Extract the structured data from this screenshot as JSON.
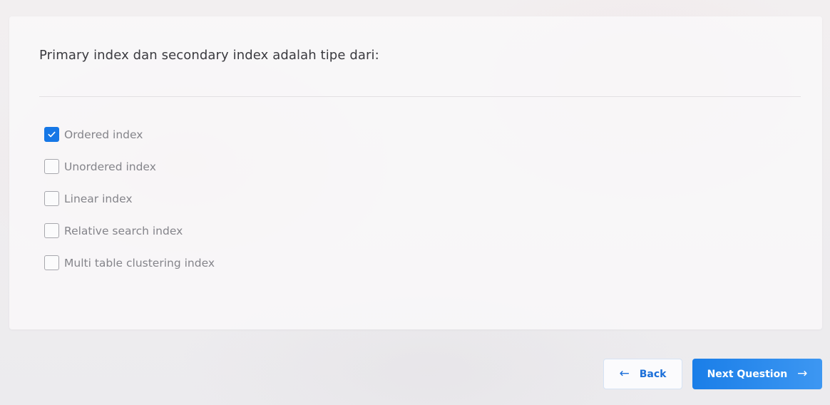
{
  "question": {
    "text": "Primary index dan secondary index adalah tipe dari:"
  },
  "options": [
    {
      "label": "Ordered index",
      "checked": true
    },
    {
      "label": "Unordered index",
      "checked": false
    },
    {
      "label": "Linear index",
      "checked": false
    },
    {
      "label": "Relative search index",
      "checked": false
    },
    {
      "label": "Multi table clustering index",
      "checked": false
    }
  ],
  "navigation": {
    "back_label": "Back",
    "back_icon": "arrow-left-icon",
    "next_label": "Next Question",
    "next_icon": "arrow-right-icon"
  },
  "colors": {
    "accent": "#1677e6",
    "checkbox_border": "#a7a7ad",
    "option_text": "#84848a",
    "question_text": "#3a3a3f"
  }
}
